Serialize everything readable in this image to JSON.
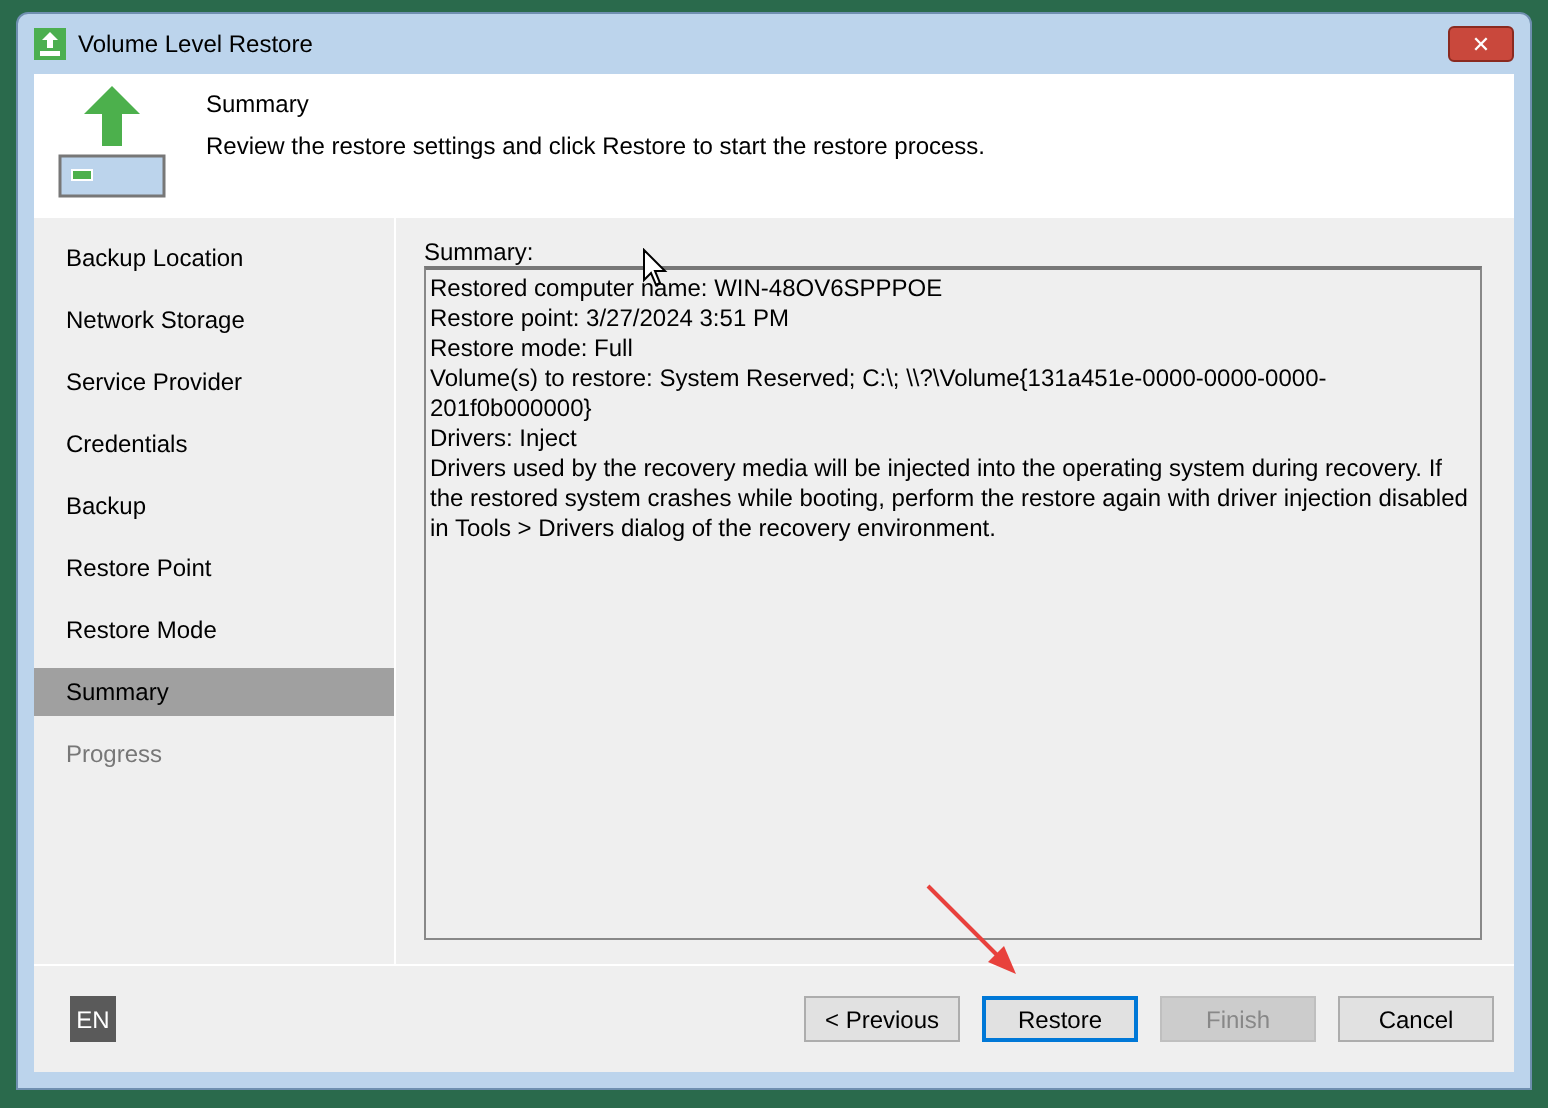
{
  "window": {
    "title": "Volume Level Restore",
    "close": "✕"
  },
  "header": {
    "title": "Summary",
    "description": "Review the restore settings and click Restore to start the restore process."
  },
  "sidebar": {
    "items": [
      {
        "label": "Backup Location",
        "selected": false,
        "disabled": false
      },
      {
        "label": "Network Storage",
        "selected": false,
        "disabled": false
      },
      {
        "label": "Service Provider",
        "selected": false,
        "disabled": false
      },
      {
        "label": "Credentials",
        "selected": false,
        "disabled": false
      },
      {
        "label": "Backup",
        "selected": false,
        "disabled": false
      },
      {
        "label": "Restore Point",
        "selected": false,
        "disabled": false
      },
      {
        "label": "Restore Mode",
        "selected": false,
        "disabled": false
      },
      {
        "label": "Summary",
        "selected": true,
        "disabled": false
      },
      {
        "label": "Progress",
        "selected": false,
        "disabled": true
      }
    ]
  },
  "summary": {
    "label": "Summary:",
    "lines": [
      "Restored computer name: WIN-48OV6SPPPOE",
      "Restore point: 3/27/2024 3:51 PM",
      "Restore mode: Full",
      "Volume(s) to restore: System Reserved; C:\\; \\\\?\\Volume{131a451e-0000-0000-0000-201f0b000000}",
      "Drivers: Inject",
      "Drivers used by the recovery media will be injected into the operating system during recovery. If the restored system crashes while booting, perform the restore again with driver injection disabled in Tools > Drivers dialog of the recovery environment."
    ]
  },
  "footer": {
    "language": "EN",
    "buttons": [
      {
        "label": "< Previous",
        "disabled": false,
        "default": false
      },
      {
        "label": "Restore",
        "disabled": false,
        "default": true
      },
      {
        "label": "Finish",
        "disabled": true,
        "default": false
      },
      {
        "label": "Cancel",
        "disabled": false,
        "default": false
      }
    ]
  }
}
